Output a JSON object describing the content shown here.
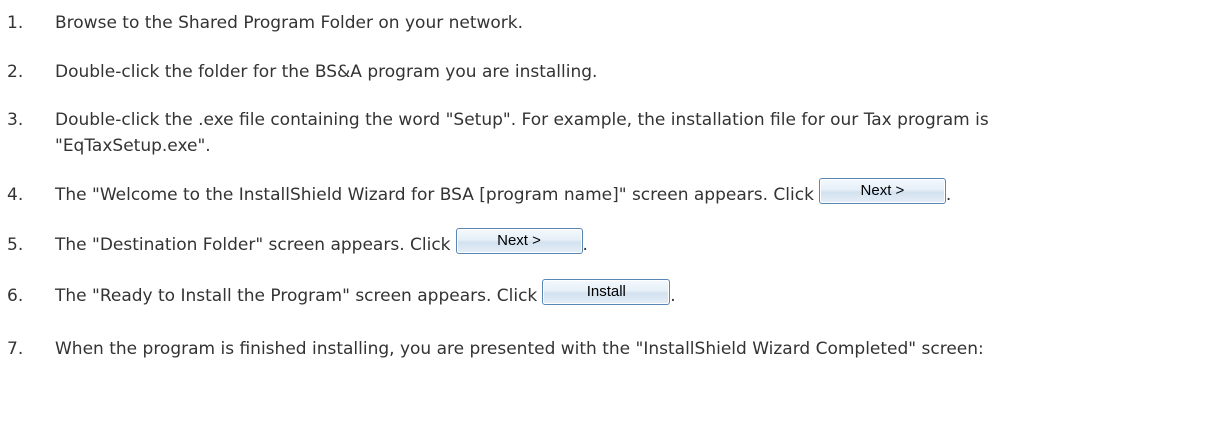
{
  "steps": [
    {
      "num": "1.",
      "text": "Browse to the Shared Program Folder on your network."
    },
    {
      "num": "2.",
      "text": "Double-click the folder for the BS&A program you are installing."
    },
    {
      "num": "3.",
      "line1": "Double-click the .exe file containing the word \"Setup\". For example, the installation file for our Tax program is",
      "line2": "\"EqTaxSetup.exe\"."
    },
    {
      "num": "4.",
      "text": "The \"Welcome to the InstallShield Wizard for BSA [program name]\" screen appears. Click",
      "button": "Next >",
      "suffix": "."
    },
    {
      "num": "5.",
      "text": "The \"Destination Folder\" screen appears. Click",
      "button": "Next >",
      "suffix": "."
    },
    {
      "num": "6.",
      "text": "The \"Ready to Install the Program\" screen appears. Click",
      "button": "Install",
      "suffix": "."
    },
    {
      "num": "7.",
      "text": "When the program is finished installing, you are presented with the \"InstallShield Wizard Completed\" screen:"
    }
  ]
}
